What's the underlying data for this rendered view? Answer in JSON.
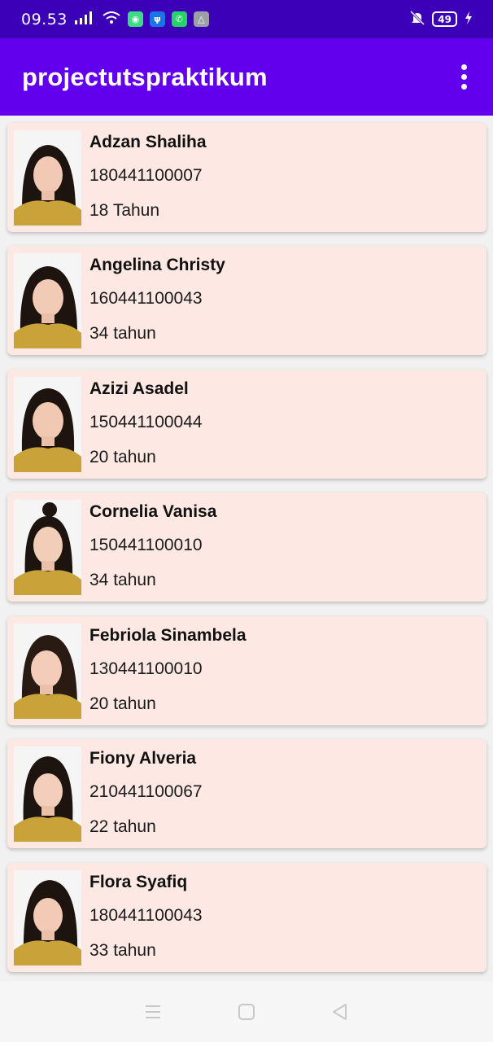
{
  "status_bar": {
    "time": "09.53",
    "battery": "49"
  },
  "app_bar": {
    "title": "projectutspraktikum"
  },
  "colors": {
    "status_bar": "#3b00b8",
    "app_bar": "#6200ee",
    "card_bg": "#fde8e4"
  },
  "students": [
    {
      "name": "Adzan Shaliha",
      "nim": "180441100007",
      "age": "18 Tahun"
    },
    {
      "name": "Angelina Christy",
      "nim": "160441100043",
      "age": "34 tahun"
    },
    {
      "name": "Azizi Asadel",
      "nim": "150441100044",
      "age": "20 tahun"
    },
    {
      "name": "Cornelia Vanisa",
      "nim": "150441100010",
      "age": "34 tahun"
    },
    {
      "name": "Febriola Sinambela",
      "nim": "130441100010",
      "age": "20 tahun"
    },
    {
      "name": "Fiony Alveria",
      "nim": "210441100067",
      "age": "22 tahun"
    },
    {
      "name": "Flora Syafiq",
      "nim": "180441100043",
      "age": "33 tahun"
    }
  ]
}
